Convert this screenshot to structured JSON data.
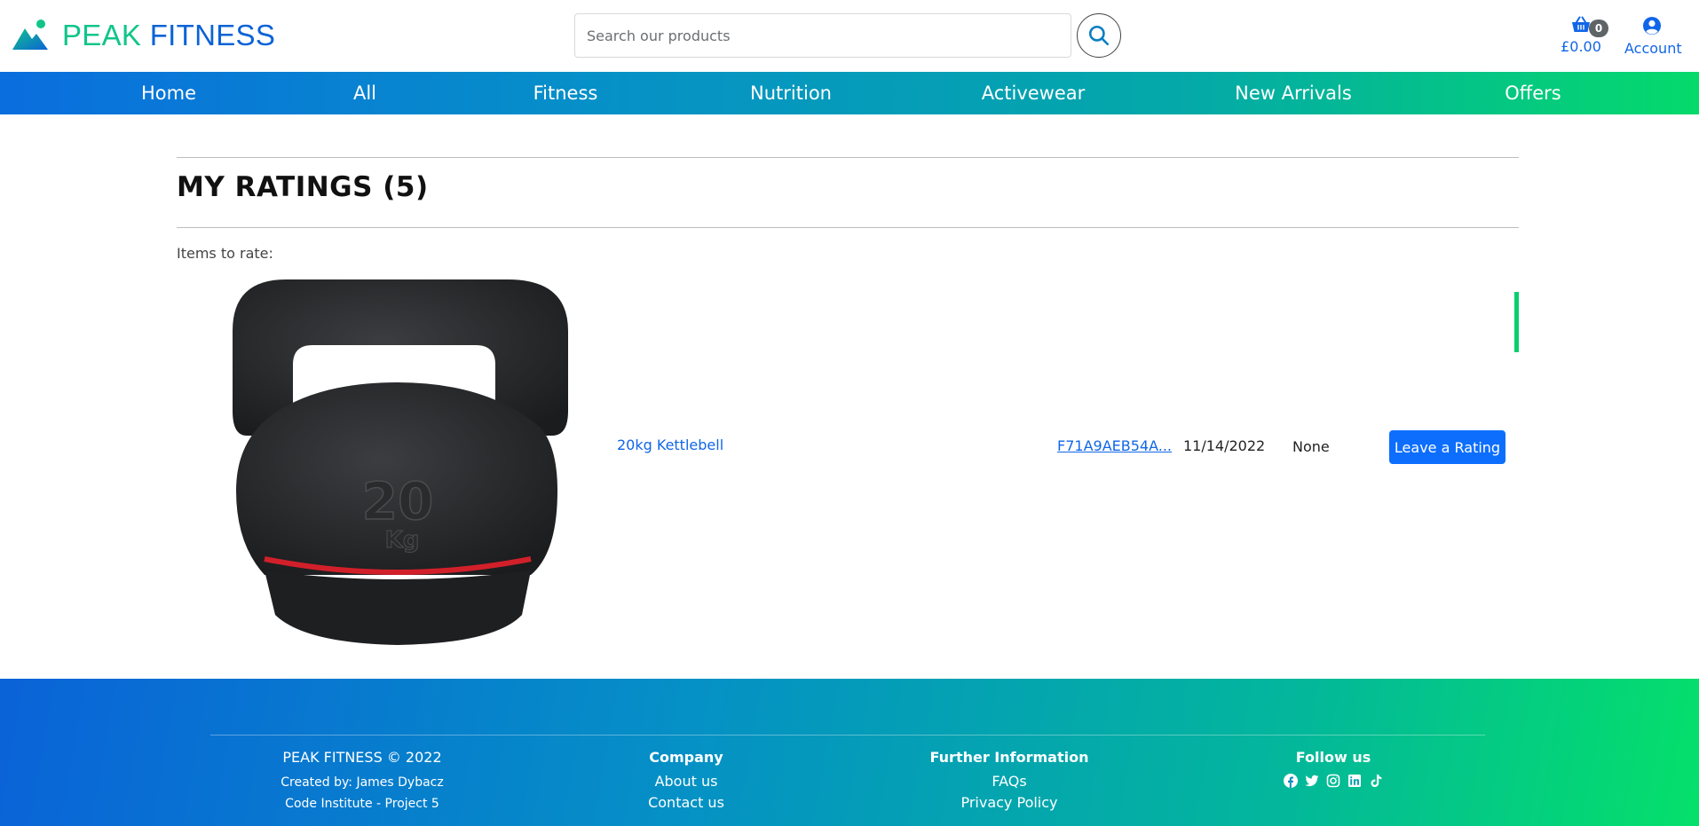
{
  "brand": {
    "word1": "PEAK",
    "word2": "FITNESS",
    "primary_color": "#0b63d6",
    "accent_color": "#10c58a"
  },
  "search": {
    "placeholder": "Search our products",
    "value": "",
    "icon": "search-icon"
  },
  "basket": {
    "count": "0",
    "total": "£0.00",
    "icon": "basket-icon"
  },
  "account": {
    "label": "Account",
    "icon": "user-circle-icon"
  },
  "nav": [
    "Home",
    "All",
    "Fitness",
    "Nutrition",
    "Activewear",
    "New Arrivals",
    "Offers"
  ],
  "page": {
    "title": "MY RATINGS (5)",
    "items_label": "Items to rate:"
  },
  "items": [
    {
      "product_name": "20kg Kettlebell",
      "order_number": "F71A9AEB54A...",
      "date": "11/14/2022",
      "rating": "None",
      "action_label": "Leave a Rating",
      "image_marking": "20 Kg"
    }
  ],
  "footer": {
    "brand_line": "PEAK FITNESS © 2022",
    "created_by": "Created by: James Dybacz",
    "project": "Code Institute - Project 5",
    "company": {
      "heading": "Company",
      "links": [
        "About us",
        "Contact us"
      ]
    },
    "further": {
      "heading": "Further Information",
      "links": [
        "FAQs",
        "Privacy Policy"
      ]
    },
    "follow": {
      "heading": "Follow us",
      "icons": [
        "facebook-icon",
        "twitter-icon",
        "instagram-icon",
        "linkedin-icon",
        "tiktok-icon"
      ]
    }
  },
  "colors": {
    "link": "#1166e8",
    "button": "#0d6efd",
    "nav_start": "#0a6ede",
    "nav_end": "#05da6b"
  }
}
